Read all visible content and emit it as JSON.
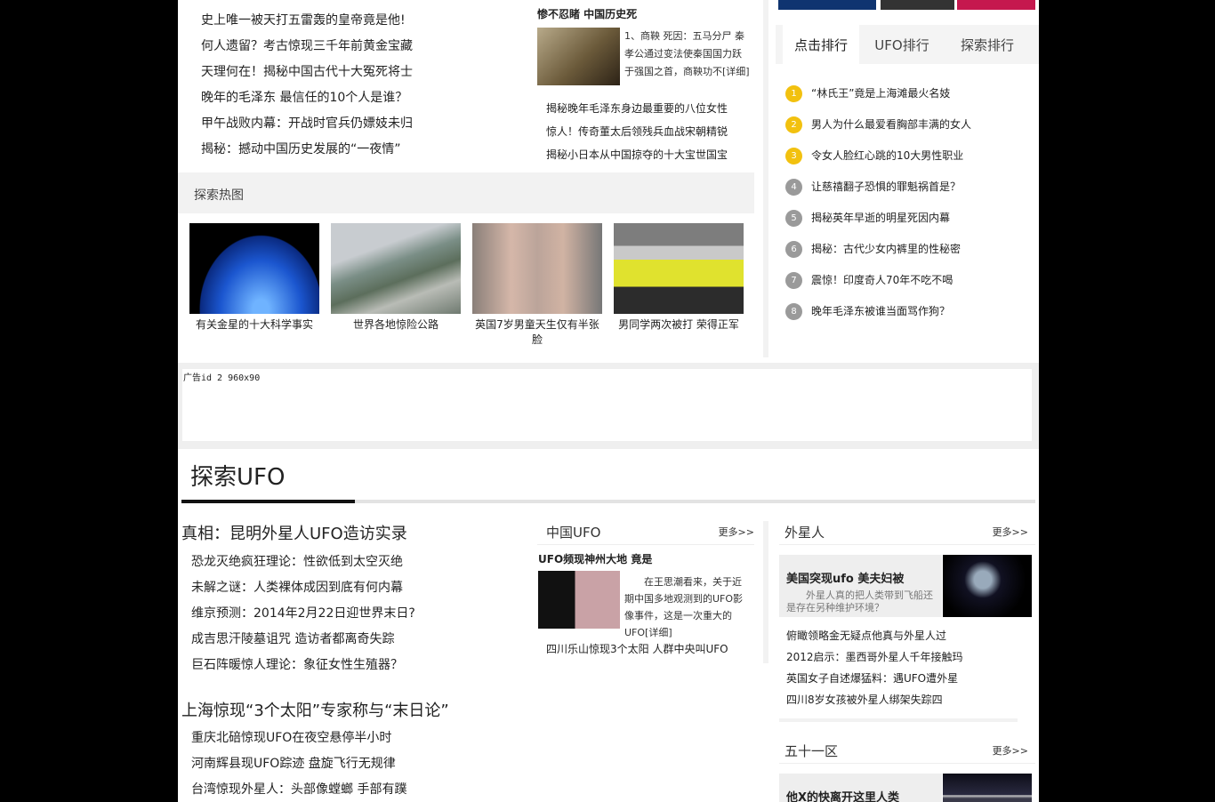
{
  "top_left_list": [
    "史上唯一被天打五雷轰的皇帝竟是他!",
    "何人遗留？考古惊现三千年前黄金宝藏",
    "天理何在！揭秘中国古代十大冤死将士",
    "晚年的毛泽东  最信任的10个人是谁？",
    "甲午战败内幕：开战时官兵仍嫖妓未归",
    "揭秘：撼动中国历史发展的“一夜情”"
  ],
  "history_box": {
    "title": "惨不忍睹  中国历史死",
    "summary": "1、商鞅        死因：五马分尸        秦孝公通过变法使秦国国力跃于强国之首，商鞅功不[详细]",
    "list": [
      "揭秘晚年毛泽东身边最重要的八位女性",
      "惊人！传奇董太后领残兵血战宋朝精锐",
      "揭秘小日本从中国掠夺的十大宝世国宝"
    ]
  },
  "hot_pics": {
    "title": "探索热图",
    "items": [
      {
        "caption": "有关金星的十大科学事实"
      },
      {
        "caption": "世界各地惊险公路"
      },
      {
        "caption": "英国7岁男童天生仅有半张脸"
      },
      {
        "caption": "男同学两次被打  荣得正军"
      }
    ]
  },
  "right_tabs": [
    "点击排行",
    "UFO排行",
    "探索排行"
  ],
  "ranking": [
    {
      "num": "1",
      "text": "“林氏王”竟是上海滩最火名妓"
    },
    {
      "num": "2",
      "text": "男人为什么最爱看胸部丰满的女人"
    },
    {
      "num": "3",
      "text": "令女人脸红心跳的10大男性职业"
    },
    {
      "num": "4",
      "text": "让慈禧翻子恐惧的罪魁祸首是？"
    },
    {
      "num": "5",
      "text": "揭秘英年早逝的明星死因内幕"
    },
    {
      "num": "6",
      "text": "揭秘：古代少女内裤里的性秘密"
    },
    {
      "num": "7",
      "text": "震惊！印度奇人70年不吃不喝"
    },
    {
      "num": "8",
      "text": "晚年毛泽东被谁当面骂作狗？"
    }
  ],
  "ad": {
    "label": "广告id 2 960x90"
  },
  "ufo_section": {
    "title": "探索UFO",
    "headline1": "真相：昆明外星人UFO造访实录",
    "list1": [
      "恐龙灭绝疯狂理论：性欲低到太空灭绝",
      "未解之谜：人类裸体成因到底有何内幕",
      "维京预测：2014年2月22日迎世界末日?",
      "成吉思汗陵墓诅咒  造访者都离奇失踪",
      "巨石阵暖惊人理论：象征女性生殖器？"
    ],
    "headline2": "上海惊现“3个太阳”专家称与“末日论”",
    "list2": [
      "重庆北碚惊现UFO在夜空悬停半小时",
      "河南辉县现UFO踪迹  盘旋飞行无规律",
      "台湾惊现外星人：头部像螳螂  手部有蹼"
    ]
  },
  "china_ufo": {
    "title": "中国UFO",
    "more": "更多>>",
    "feature_title": "UFO频现神州大地  竟是",
    "summary": "在王思潮看来，关于近期中国多地观测到的UFO影像事件，这是一次重大的UFO[详细]",
    "list": [
      "四川乐山惊现3个太阳  人群中央叫UFO"
    ]
  },
  "aliens": {
    "title": "外星人",
    "more": "更多>>",
    "feature_title": "美国突现ufo 美夫妇被",
    "feature_sub": "外星人真的把人类带到飞船还是存在另种维护环境？",
    "list": [
      "俯瞰领略金无疑点他真与外星人过",
      "2012启示：墨西哥外星人千年接触玛",
      "英国女子自述爆猛料：遇UFO遭外星",
      "四川8岁女孩被外星人绑架失踪四"
    ]
  },
  "area51": {
    "title": "五十一区",
    "more": "更多>>",
    "feature_title": "他X的快离开这里人类"
  },
  "colors": {
    "accent_bar": "#111111",
    "rank_top": "#f2c10f",
    "rank_other": "#9a9a9a",
    "nav_blue": "#0f3470",
    "nav_pink": "#c5184e"
  }
}
